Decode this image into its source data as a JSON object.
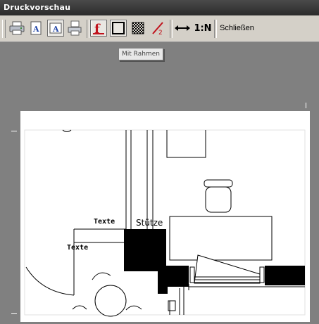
{
  "window": {
    "title": "Druckvorschau"
  },
  "toolbar": {
    "print_icon": "printer-icon",
    "close_label": "Schließen",
    "scale_label": "1:N",
    "tooltip": "Mit Rahmen"
  },
  "drawing": {
    "labels": [
      "Texte",
      "Texte",
      "Stütze"
    ]
  }
}
